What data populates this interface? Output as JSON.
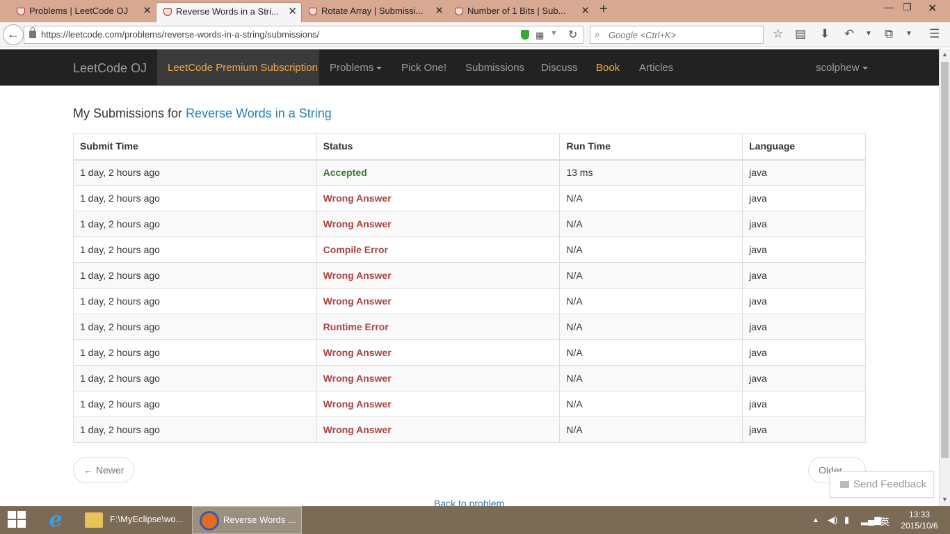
{
  "browser": {
    "tabs": [
      {
        "title": "Problems | LeetCode OJ",
        "active": false
      },
      {
        "title": "Reverse Words in a Stri...",
        "active": true
      },
      {
        "title": "Rotate Array | Submissi...",
        "active": false
      },
      {
        "title": "Number of 1 Bits | Sub...",
        "active": false
      }
    ],
    "url": "https://leetcode.com/problems/reverse-words-in-a-string/submissions/",
    "search_placeholder": "Google <Ctrl+K>"
  },
  "site": {
    "brand": "LeetCode OJ",
    "nav": {
      "premium": "LeetCode Premium Subscription",
      "problems": "Problems",
      "pick_one": "Pick One!",
      "submissions": "Submissions",
      "discuss": "Discuss",
      "book": "Book",
      "articles": "Articles",
      "user": "scolphew"
    }
  },
  "page": {
    "heading_prefix": "My Submissions for",
    "problem_title": "Reverse Words in a String",
    "columns": [
      "Submit Time",
      "Status",
      "Run Time",
      "Language"
    ],
    "rows": [
      {
        "time": "1 day, 2 hours ago",
        "status": "Accepted",
        "runtime": "13 ms",
        "lang": "java"
      },
      {
        "time": "1 day, 2 hours ago",
        "status": "Wrong Answer",
        "runtime": "N/A",
        "lang": "java"
      },
      {
        "time": "1 day, 2 hours ago",
        "status": "Wrong Answer",
        "runtime": "N/A",
        "lang": "java"
      },
      {
        "time": "1 day, 2 hours ago",
        "status": "Compile Error",
        "runtime": "N/A",
        "lang": "java"
      },
      {
        "time": "1 day, 2 hours ago",
        "status": "Wrong Answer",
        "runtime": "N/A",
        "lang": "java"
      },
      {
        "time": "1 day, 2 hours ago",
        "status": "Wrong Answer",
        "runtime": "N/A",
        "lang": "java"
      },
      {
        "time": "1 day, 2 hours ago",
        "status": "Runtime Error",
        "runtime": "N/A",
        "lang": "java"
      },
      {
        "time": "1 day, 2 hours ago",
        "status": "Wrong Answer",
        "runtime": "N/A",
        "lang": "java"
      },
      {
        "time": "1 day, 2 hours ago",
        "status": "Wrong Answer",
        "runtime": "N/A",
        "lang": "java"
      },
      {
        "time": "1 day, 2 hours ago",
        "status": "Wrong Answer",
        "runtime": "N/A",
        "lang": "java"
      },
      {
        "time": "1 day, 2 hours ago",
        "status": "Wrong Answer",
        "runtime": "N/A",
        "lang": "java"
      }
    ],
    "newer": "← Newer",
    "older": "Older",
    "back_to_problem": "Back to problem",
    "send_feedback": "Send Feedback"
  },
  "taskbar": {
    "explorer_label": "F:\\MyEclipse\\wo...",
    "firefox_label": "Reverse Words ...",
    "ime": "英",
    "time": "13:33",
    "date": "2015/10/6"
  },
  "colors": {
    "accepted": "#3c763d",
    "error": "#a94442",
    "link": "#2a7fb5",
    "premium": "#f0ad4e",
    "navbar": "#222222"
  }
}
